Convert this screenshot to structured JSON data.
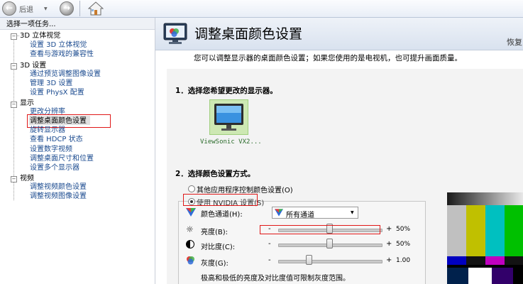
{
  "toolbar": {
    "back_label": "后退",
    "back_icon": "back-arrow-icon",
    "forward_icon": "forward-arrow-icon",
    "home_icon": "home-icon"
  },
  "sidebar": {
    "header": "选择一项任务...",
    "categories": [
      {
        "label": "3D 立体视觉",
        "items": [
          "设置 3D 立体视觉",
          "查看与游戏的兼容性"
        ]
      },
      {
        "label": "3D 设置",
        "items": [
          "通过预览调整图像设置",
          "管理 3D 设置",
          "设置 PhysX 配置"
        ]
      },
      {
        "label": "显示",
        "items": [
          "更改分辨率",
          "调整桌面颜色设置",
          "旋转显示器",
          "查看 HDCP 状态",
          "设置数字视频",
          "调整桌面尺寸和位置",
          "设置多个显示器"
        ]
      },
      {
        "label": "视频",
        "items": [
          "调整视频颜色设置",
          "调整视频图像设置"
        ]
      }
    ]
  },
  "main": {
    "title": "调整桌面颜色设置",
    "restore": "恢复",
    "description": "您可以调整显示器的桌面颜色设置；如果您使用的是电视机，也可提升画面质量。",
    "section1": "1．选择您希望更改的显示器。",
    "monitor_label": "ViewSonic VX2...",
    "section2": "2．选择颜色设置方式。",
    "radio_other": "其他应用程序控制颜色设置(O)",
    "radio_nvidia": "使用 NVIDIA 设置(S)",
    "channel_label": "颜色通道(H):",
    "channel_value": "所有通道",
    "brightness_label": "亮度(B):",
    "brightness_value": "50%",
    "brightness_level": 0.5,
    "contrast_label": "对比度(C):",
    "contrast_value": "50%",
    "contrast_level": 0.5,
    "gamma_label": "灰度(G):",
    "gamma_value": "1.00",
    "gamma_level": 0.3,
    "minus": "-",
    "plus": "+",
    "note": "极高和极低的亮度及对比度值可限制灰度范围。"
  },
  "colors": {
    "accent_red": "#e01818",
    "link": "#1a4a8f"
  }
}
